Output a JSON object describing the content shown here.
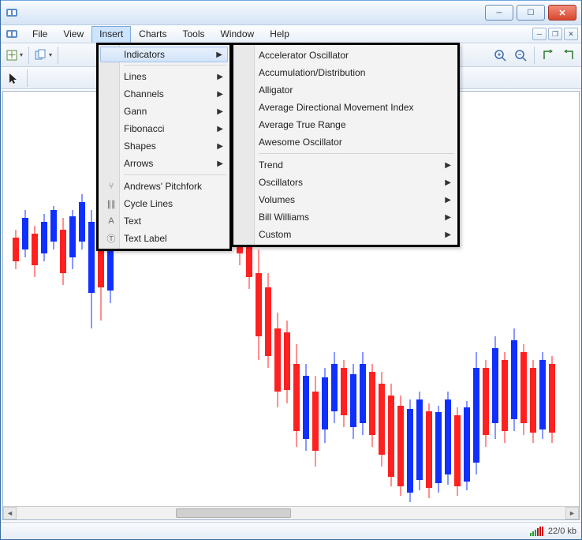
{
  "window": {
    "title": ""
  },
  "menubar": {
    "items": [
      "File",
      "View",
      "Insert",
      "Charts",
      "Tools",
      "Window",
      "Help"
    ],
    "open_index": 2
  },
  "insert_menu": {
    "items": [
      {
        "label": "Indicators",
        "has_sub": true,
        "selected": true
      },
      {
        "sep": true
      },
      {
        "label": "Lines",
        "has_sub": true
      },
      {
        "label": "Channels",
        "has_sub": true
      },
      {
        "label": "Gann",
        "has_sub": true
      },
      {
        "label": "Fibonacci",
        "has_sub": true
      },
      {
        "label": "Shapes",
        "has_sub": true
      },
      {
        "label": "Arrows",
        "has_sub": true
      },
      {
        "sep": true
      },
      {
        "label": "Andrews' Pitchfork",
        "icon": "pitchfork"
      },
      {
        "label": "Cycle Lines",
        "icon": "cycle"
      },
      {
        "label": "Text",
        "icon": "text"
      },
      {
        "label": "Text Label",
        "icon": "textlabel"
      }
    ]
  },
  "indicators_menu": {
    "items": [
      {
        "label": "Accelerator Oscillator"
      },
      {
        "label": "Accumulation/Distribution"
      },
      {
        "label": "Alligator"
      },
      {
        "label": "Average Directional Movement Index"
      },
      {
        "label": "Average True Range"
      },
      {
        "label": "Awesome Oscillator"
      },
      {
        "sep": true
      },
      {
        "label": "Trend",
        "has_sub": true
      },
      {
        "label": "Oscillators",
        "has_sub": true
      },
      {
        "label": "Volumes",
        "has_sub": true
      },
      {
        "label": "Bill Williams",
        "has_sub": true
      },
      {
        "label": "Custom",
        "has_sub": true
      }
    ]
  },
  "statusbar": {
    "conn": "22/0 kb"
  },
  "chart_data": {
    "type": "candlestick",
    "title": "",
    "xlabel": "",
    "ylabel": "",
    "ylim": [
      0,
      560
    ],
    "note": "Axis values not labeled in screenshot; candle values are pixel-derived relative positions (top of chart = 0). Each candle: [x_px, wick_top, wick_bottom, body_top, body_bottom, direction].",
    "candles": [
      [
        12,
        175,
        225,
        185,
        215,
        "down"
      ],
      [
        24,
        150,
        210,
        160,
        200,
        "up"
      ],
      [
        36,
        170,
        235,
        180,
        220,
        "down"
      ],
      [
        48,
        155,
        215,
        165,
        205,
        "up"
      ],
      [
        60,
        145,
        200,
        150,
        190,
        "up"
      ],
      [
        72,
        160,
        245,
        175,
        230,
        "down"
      ],
      [
        84,
        150,
        225,
        158,
        210,
        "up"
      ],
      [
        96,
        130,
        200,
        140,
        190,
        "up"
      ],
      [
        108,
        150,
        300,
        165,
        255,
        "up"
      ],
      [
        120,
        158,
        290,
        175,
        248,
        "down"
      ],
      [
        132,
        170,
        268,
        185,
        252,
        "up"
      ],
      [
        296,
        140,
        220,
        155,
        205,
        "down"
      ],
      [
        308,
        160,
        250,
        175,
        235,
        "down"
      ],
      [
        320,
        200,
        340,
        230,
        310,
        "down"
      ],
      [
        332,
        230,
        350,
        248,
        335,
        "down"
      ],
      [
        344,
        280,
        400,
        300,
        380,
        "down"
      ],
      [
        356,
        290,
        395,
        305,
        378,
        "down"
      ],
      [
        368,
        320,
        450,
        345,
        430,
        "down"
      ],
      [
        380,
        345,
        455,
        360,
        440,
        "up"
      ],
      [
        392,
        360,
        475,
        380,
        455,
        "down"
      ],
      [
        404,
        350,
        445,
        362,
        428,
        "up"
      ],
      [
        416,
        330,
        420,
        345,
        405,
        "up"
      ],
      [
        428,
        340,
        425,
        350,
        410,
        "down"
      ],
      [
        440,
        345,
        440,
        358,
        425,
        "up"
      ],
      [
        452,
        330,
        435,
        345,
        420,
        "up"
      ],
      [
        464,
        345,
        450,
        355,
        435,
        "down"
      ],
      [
        476,
        355,
        475,
        370,
        460,
        "down"
      ],
      [
        488,
        370,
        500,
        385,
        488,
        "down"
      ],
      [
        500,
        385,
        512,
        398,
        500,
        "down"
      ],
      [
        512,
        390,
        520,
        402,
        508,
        "up"
      ],
      [
        524,
        380,
        505,
        390,
        492,
        "up"
      ],
      [
        536,
        395,
        515,
        405,
        502,
        "down"
      ],
      [
        548,
        398,
        508,
        406,
        496,
        "up"
      ],
      [
        560,
        380,
        498,
        390,
        485,
        "up"
      ],
      [
        572,
        400,
        512,
        410,
        500,
        "down"
      ],
      [
        584,
        392,
        505,
        400,
        494,
        "up"
      ],
      [
        596,
        330,
        485,
        350,
        470,
        "up"
      ],
      [
        608,
        340,
        450,
        350,
        435,
        "down"
      ],
      [
        620,
        310,
        440,
        325,
        420,
        "up"
      ],
      [
        632,
        330,
        445,
        340,
        430,
        "down"
      ],
      [
        644,
        300,
        430,
        315,
        415,
        "up"
      ],
      [
        656,
        320,
        435,
        330,
        420,
        "down"
      ],
      [
        668,
        340,
        445,
        350,
        432,
        "down"
      ],
      [
        680,
        330,
        440,
        340,
        428,
        "up"
      ],
      [
        692,
        335,
        445,
        345,
        432,
        "down"
      ]
    ]
  }
}
